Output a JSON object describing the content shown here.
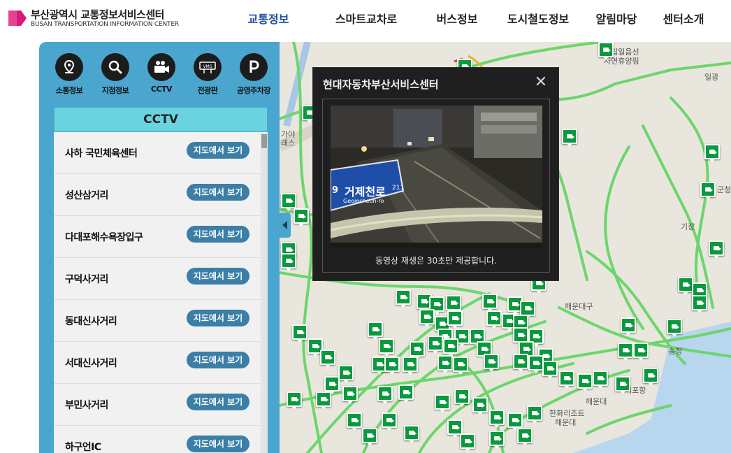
{
  "header": {
    "logo_kr": "부산광역시 교통정보서비스센터",
    "logo_en": "BUSAN TRANSPORTATION INFORMATION CENTER",
    "nav": [
      {
        "label": "교통정보",
        "active": true
      },
      {
        "label": "스마트교차로"
      },
      {
        "label": "버스정보"
      },
      {
        "label": "도시철도정보"
      },
      {
        "label": "알림마당"
      },
      {
        "label": "센터소개"
      }
    ]
  },
  "sidebar": {
    "tools": [
      {
        "label": "소통정보",
        "icon": "map-pin-icon"
      },
      {
        "label": "지점정보",
        "icon": "search-icon"
      },
      {
        "label": "CCTV",
        "icon": "video-camera-icon"
      },
      {
        "label": "전광판",
        "icon": "vms-sign-icon"
      },
      {
        "label": "공영주차장",
        "icon": "parking-icon"
      }
    ],
    "panel_title": "CCTV",
    "button_label": "지도에서 보기",
    "items": [
      "사하 국민체육센터",
      "성산삼거리",
      "다대포해수욕장입구",
      "구덕사거리",
      "동대신사거리",
      "서대신사거리",
      "부민사거리",
      "하구언IC"
    ]
  },
  "popup": {
    "title": "현대자동차부산서비스센터",
    "close": "✕",
    "note": "동영상 재생은 30초만 제공합니다.",
    "sign_kr": "거제천로",
    "sign_en": "Geojecheon-ro",
    "sign_num": "211",
    "sign_prefix": "9"
  },
  "map": {
    "labels": [
      {
        "text": "국립일음선"
      },
      {
        "text": "자연휴양림"
      },
      {
        "text": "일광"
      },
      {
        "text": "기장"
      },
      {
        "text": "해운대구"
      },
      {
        "text": "송정"
      },
      {
        "text": "해운대"
      },
      {
        "text": "미포항"
      },
      {
        "text": "한화리조트"
      },
      {
        "text": "해운대"
      },
      {
        "text": "군청"
      },
      {
        "text": "가야"
      },
      {
        "text": "래스"
      }
    ]
  },
  "colors": {
    "sidebar": "#4aa6cf",
    "panel_header": "#6ad3e0",
    "button": "#3b7fa7",
    "marker": "#0a9a3e",
    "road": "#6cd66a",
    "nav_active": "#1d4e9e"
  }
}
